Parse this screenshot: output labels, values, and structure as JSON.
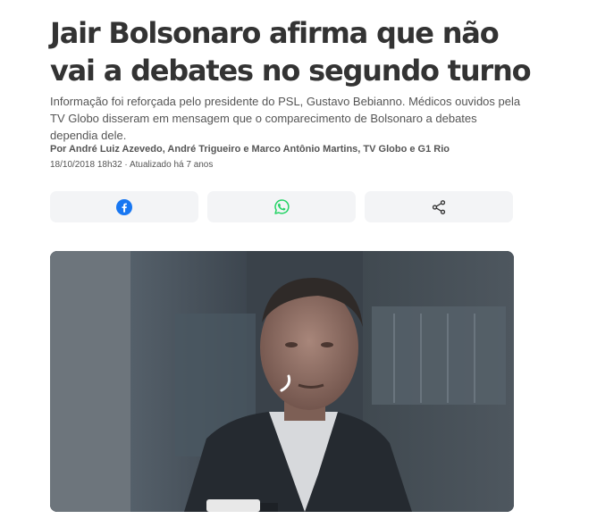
{
  "article": {
    "title": "Jair Bolsonaro afirma que não vai a debates no segundo turno",
    "subtitle": "Informação foi reforçada pelo presidente do PSL, Gustavo Bebianno. Médicos ouvidos pela TV Globo disseram em mensagem que o comparecimento de Bolsonaro a debates dependia dele.",
    "byline": "Por André Luiz Azevedo, André Trigueiro e Marco Antônio Martins, TV Globo e G1 Rio",
    "meta": "18/10/2018 18h32 · Atualizado há 7 anos"
  },
  "share": {
    "buttons": [
      {
        "icon": "facebook-icon",
        "color": "#1877f2"
      },
      {
        "icon": "whatsapp-icon",
        "color": "#25d366"
      },
      {
        "icon": "share-icon",
        "color": "#333333"
      }
    ]
  },
  "media": {
    "type": "video",
    "state": "loading"
  }
}
